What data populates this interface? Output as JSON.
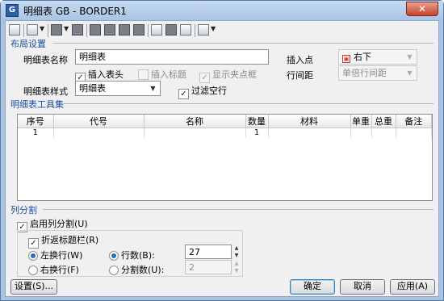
{
  "window": {
    "title": "明细表 GB - BORDER1",
    "close_label": "✕"
  },
  "layout": {
    "section_label": "布局设置",
    "name_label": "明细表名称",
    "name_value": "明细表",
    "insert_point_label": "插入点",
    "insert_point_value": "右下",
    "insert_header_label": "插入表头",
    "insert_title_label": "插入标题",
    "show_grip_label": "显示夹点框",
    "row_spacing_label": "行间距",
    "row_spacing_value": "单倍行间距",
    "style_label": "明细表样式",
    "style_value": "明细表",
    "filter_empty_label": "过滤空行"
  },
  "toolset": {
    "section_label": "明细表工具集",
    "columns": [
      "序号",
      "代号",
      "名称",
      "数量",
      "材料",
      "单重",
      "总重",
      "备注"
    ],
    "rows": [
      [
        "1",
        "",
        "",
        "1",
        "",
        "",
        "",
        ""
      ]
    ]
  },
  "split": {
    "section_label": "列分割",
    "enable_label": "启用列分割(U)",
    "fold_title_label": "折返标题栏(R)",
    "left_wrap_label": "左换行(W)",
    "right_wrap_label": "右换行(F)",
    "row_count_label": "行数(B):",
    "row_count_value": "27",
    "split_count_label": "分割数(U):",
    "split_count_value": "2"
  },
  "buttons": {
    "settings": "设置(S)...",
    "ok": "确定",
    "cancel": "取消",
    "apply": "应用(A)"
  }
}
